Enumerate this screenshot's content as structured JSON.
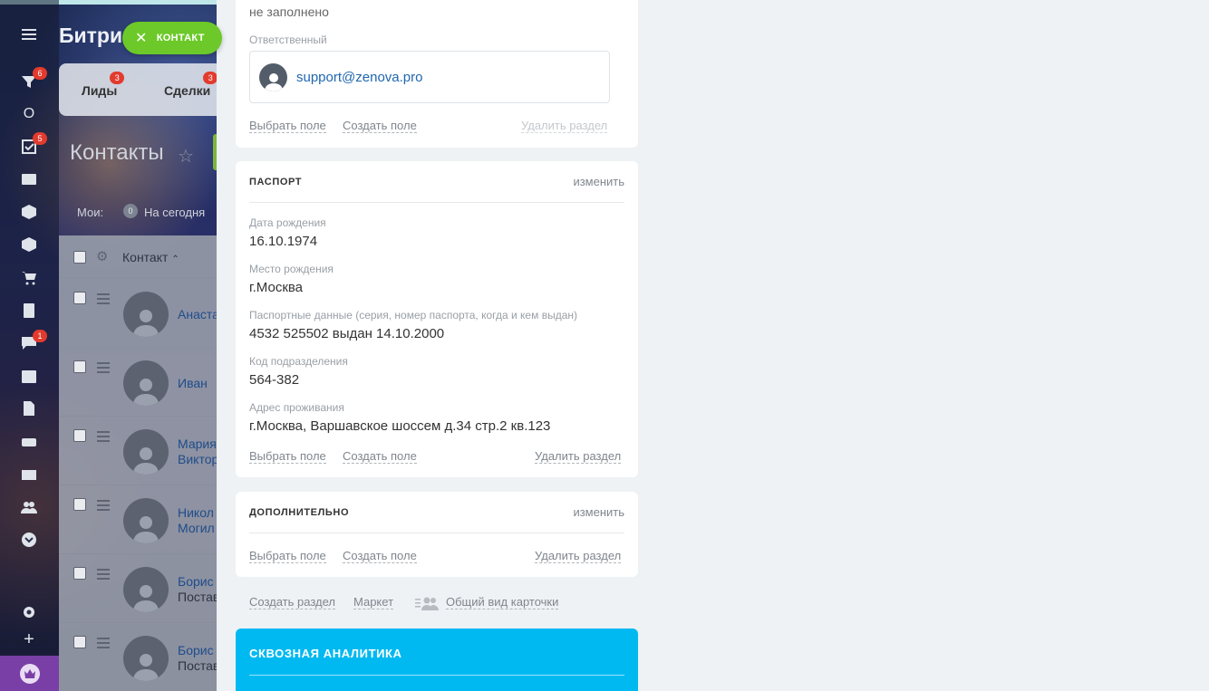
{
  "background": {
    "brand": "Битри",
    "contact_chip": "КОНТАКТ",
    "left_bar": {
      "badges": [
        "6",
        "5",
        "1"
      ],
      "o_label": "O",
      "icons": [
        "menu-icon",
        "filter-icon",
        "tasks-icon",
        "contact-card-icon",
        "box-icon",
        "box2-icon",
        "cart-icon",
        "document-icon",
        "chat-icon",
        "calendar-icon",
        "file-icon",
        "drive-icon",
        "mail-icon",
        "group-icon",
        "chevron-down-icon",
        "settings-icon",
        "plus-icon"
      ]
    },
    "crm_tabs": [
      {
        "label": "Лиды",
        "badge": "3"
      },
      {
        "label": "Сделки",
        "badge": "3"
      }
    ],
    "page_title": "Контакты",
    "filter": {
      "moi": "Мои:",
      "count": "0",
      "today": "На сегодня"
    },
    "grid": {
      "column": "Контакт",
      "rows": [
        {
          "name": "Анаста",
          "sub": ""
        },
        {
          "name": "Иван",
          "sub": ""
        },
        {
          "name": "Мария",
          "sub": "Виктор"
        },
        {
          "name": "Никол",
          "sub": "Могил"
        },
        {
          "name": "Борис",
          "sub": "Постав"
        },
        {
          "name": "Борис",
          "sub": "Постав"
        }
      ]
    }
  },
  "slider": {
    "top_card": {
      "empty_value": "не заполнено",
      "responsible_label": "Ответственный",
      "responsible_email": "support@zenova.pro",
      "select_field": "Выбрать поле",
      "create_field": "Создать поле",
      "delete_section": "Удалить раздел"
    },
    "passport": {
      "title": "ПАСПОРТ",
      "edit": "изменить",
      "fields": [
        {
          "label": "Дата рождения",
          "value": "16.10.1974"
        },
        {
          "label": "Место рождения",
          "value": "г.Москва"
        },
        {
          "label": "Паспортные данные (серия, номер паспорта, когда и кем выдан)",
          "value": "4532 525502 выдан 14.10.2000"
        },
        {
          "label": "Код подразделения",
          "value": "564-382"
        },
        {
          "label": "Адрес проживания",
          "value": "г.Москва, Варшавское шоссем д.34 стр.2 кв.123"
        }
      ],
      "select_field": "Выбрать поле",
      "create_field": "Создать поле",
      "delete_section": "Удалить раздел"
    },
    "extra": {
      "title": "ДОПОЛНИТЕЛЬНО",
      "edit": "изменить",
      "select_field": "Выбрать поле",
      "create_field": "Создать поле",
      "delete_section": "Удалить раздел"
    },
    "bottom_links": {
      "create_section": "Создать раздел",
      "market": "Маркет",
      "general_view": "Общий вид карточки"
    },
    "analytics": {
      "title": "СКВОЗНАЯ АНАЛИТИКА"
    }
  },
  "colors": {
    "accent_green": "#6cc929",
    "link_blue": "#2067b0",
    "analytics_blue": "#00b9f1",
    "badge_red": "#e23b2e"
  }
}
